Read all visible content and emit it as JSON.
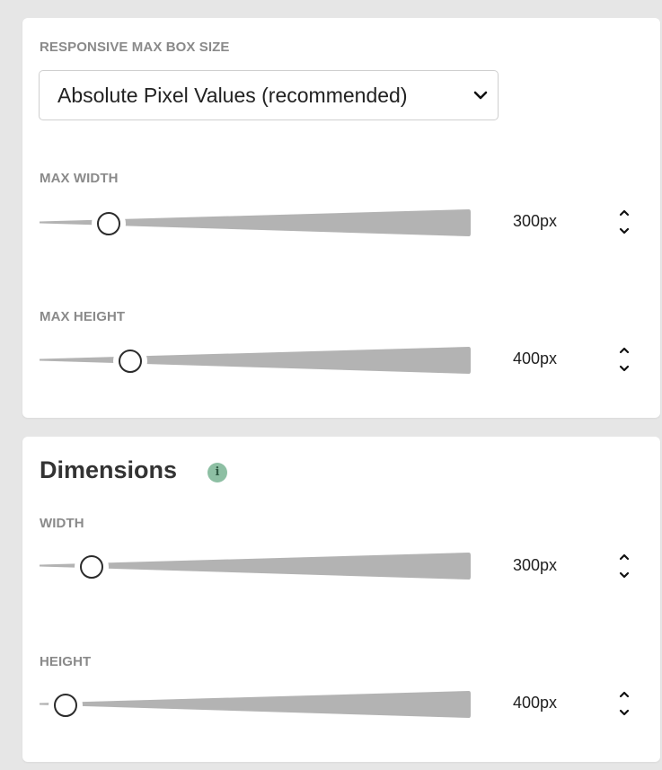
{
  "responsive_panel": {
    "section_label": "RESPONSIVE MAX BOX SIZE",
    "select": {
      "value": "Absolute Pixel Values (recommended)",
      "icon": "chevron-down-icon"
    },
    "max_width": {
      "label": "MAX WIDTH",
      "value_text": "300px",
      "slider_fraction": 0.16
    },
    "max_height": {
      "label": "MAX HEIGHT",
      "value_text": "400px",
      "slider_fraction": 0.21
    }
  },
  "dimensions_panel": {
    "title": "Dimensions",
    "info_icon": "i",
    "width": {
      "label": "WIDTH",
      "value_text": "300px",
      "slider_fraction": 0.12
    },
    "height": {
      "label": "HEIGHT",
      "value_text": "400px",
      "slider_fraction": 0.06
    }
  },
  "colors": {
    "track": "#b3b3b3",
    "thumb_border": "#2b2b2b",
    "info_icon_bg": "#8dbfa3",
    "background": "#e6e6e6"
  }
}
